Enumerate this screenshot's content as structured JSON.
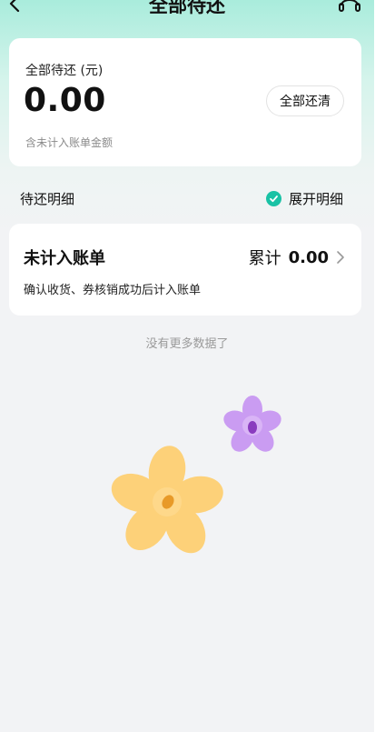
{
  "header": {
    "title": "全部待还",
    "back_icon": "chevron-left-icon",
    "service_icon": "headset-icon"
  },
  "summary": {
    "label": "全部待还 (元)",
    "amount": "0.00",
    "repay_all_button": "全部还清",
    "note": "含未计入账单金额"
  },
  "details": {
    "title": "待还明细",
    "expand_label": "展开明细",
    "expand_checked": true,
    "accent_color": "#19c2a5"
  },
  "bill": {
    "title": "未计入账单",
    "total_label": "累计",
    "total_value": "0.00",
    "description": "确认收货、券核销成功后计入账单"
  },
  "footer": {
    "no_more_text": "没有更多数据了"
  },
  "illustration": {
    "icon": "flowers-illustration",
    "colors": [
      "#fdd179",
      "#ca9cf2"
    ]
  }
}
